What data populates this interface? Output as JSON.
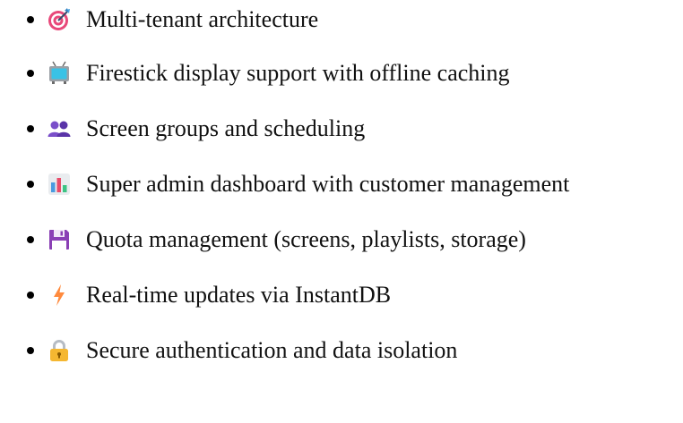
{
  "features": [
    {
      "icon": "dart-target-icon",
      "text": "Multi-tenant architecture"
    },
    {
      "icon": "television-icon",
      "text": "Firestick display support with offline caching"
    },
    {
      "icon": "users-group-icon",
      "text": "Screen groups and scheduling"
    },
    {
      "icon": "bar-chart-icon",
      "text": "Super admin dashboard with customer management"
    },
    {
      "icon": "floppy-disk-icon",
      "text": "Quota management (screens, playlists, storage)"
    },
    {
      "icon": "lightning-bolt-icon",
      "text": "Real-time updates via InstantDB"
    },
    {
      "icon": "padlock-icon",
      "text": "Secure authentication and data isolation"
    }
  ]
}
